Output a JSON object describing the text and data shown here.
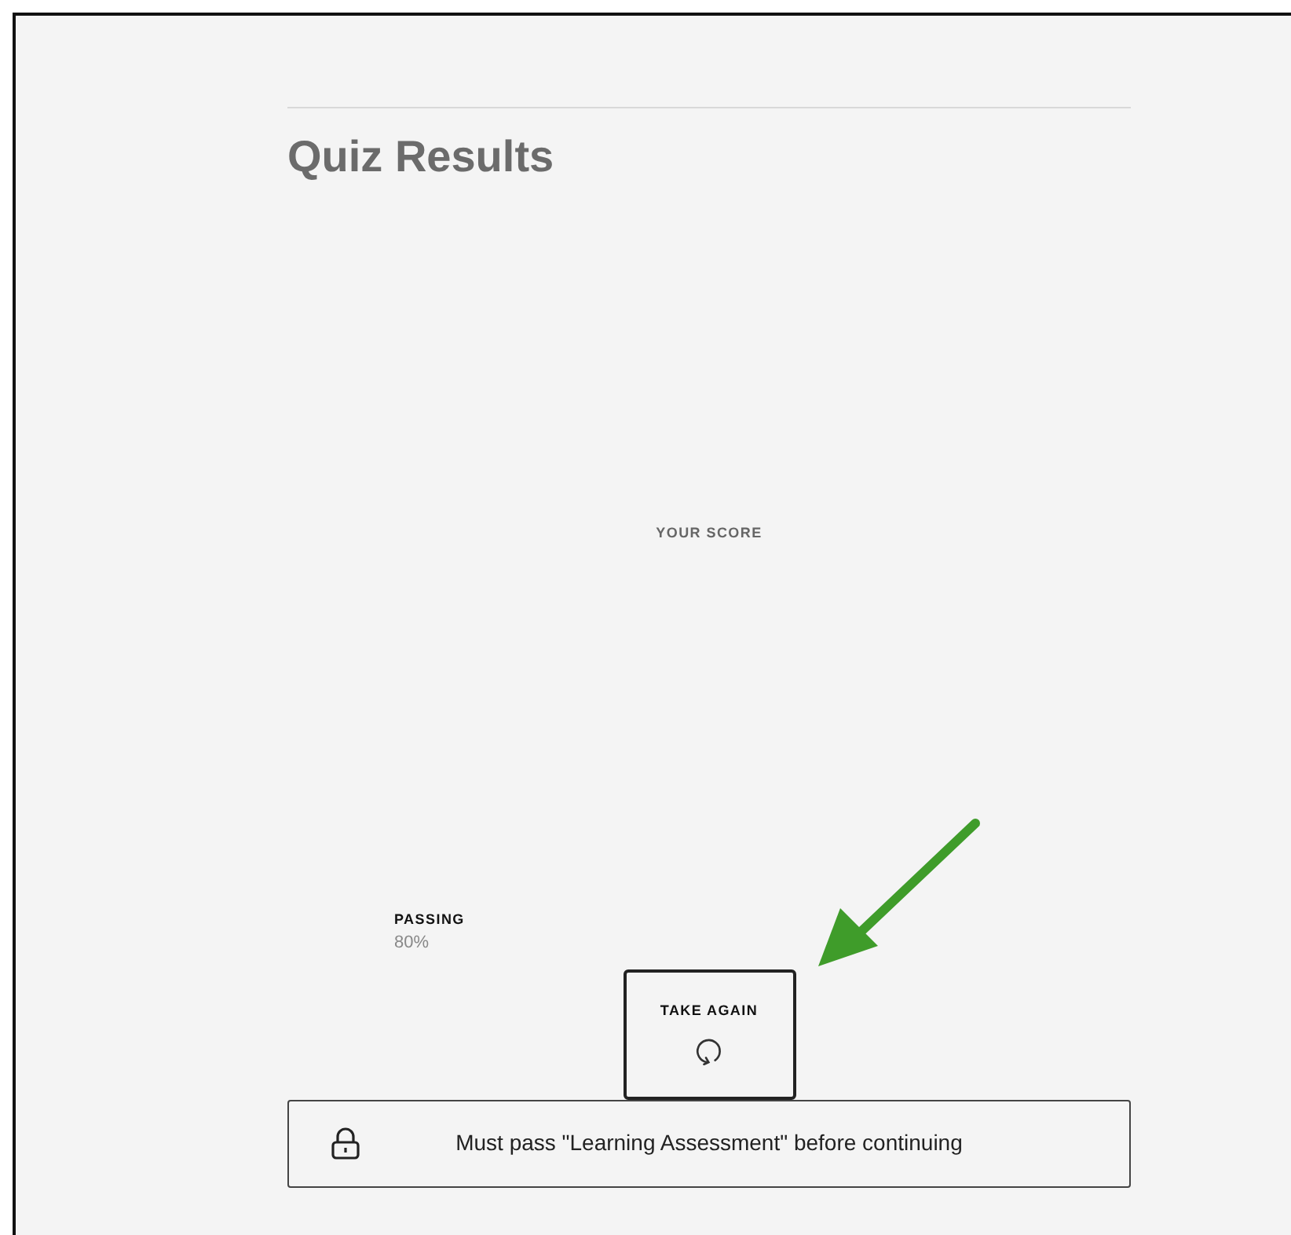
{
  "title": "Quiz Results",
  "score": {
    "label": "YOUR SCORE"
  },
  "passing": {
    "label": "PASSING",
    "value": "80%"
  },
  "retry_button": {
    "label": "TAKE AGAIN"
  },
  "notice": {
    "text": "Must pass \"Learning Assessment\" before continuing"
  }
}
